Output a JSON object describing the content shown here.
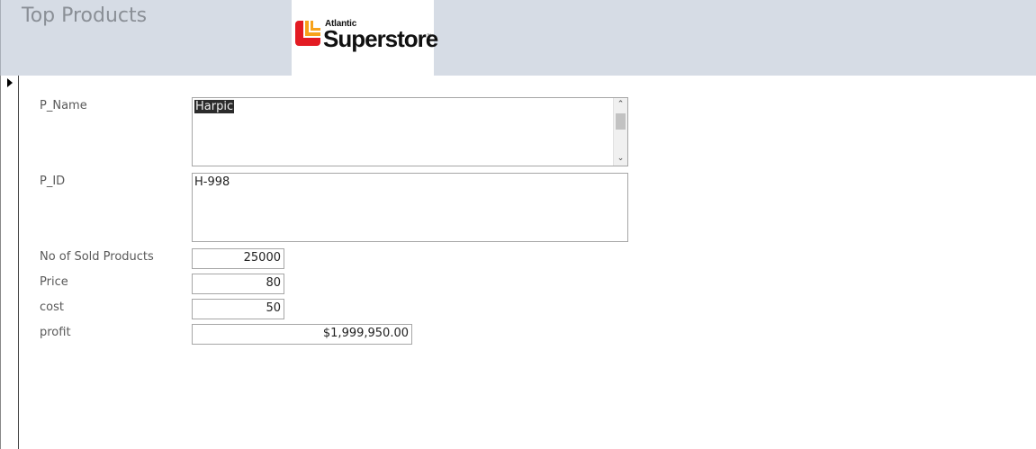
{
  "form": {
    "title": "Top Products"
  },
  "logo": {
    "brand_small": "Atlantic",
    "brand_big": "Superstore"
  },
  "fields": {
    "p_name": {
      "label": "P_Name",
      "value": "Harpic"
    },
    "p_id": {
      "label": "P_ID",
      "value": "H-998"
    },
    "sold": {
      "label": "No of Sold Products",
      "value": "25000"
    },
    "price": {
      "label": "Price",
      "value": "80"
    },
    "cost": {
      "label": "cost",
      "value": "50"
    },
    "profit": {
      "label": "profit",
      "value": "$1,999,950.00"
    }
  },
  "colors": {
    "header_bg": "#d6dce5",
    "logo_red": "#e31b23",
    "logo_orange": "#f7a21b",
    "selection_bg": "#2b2b2b"
  }
}
